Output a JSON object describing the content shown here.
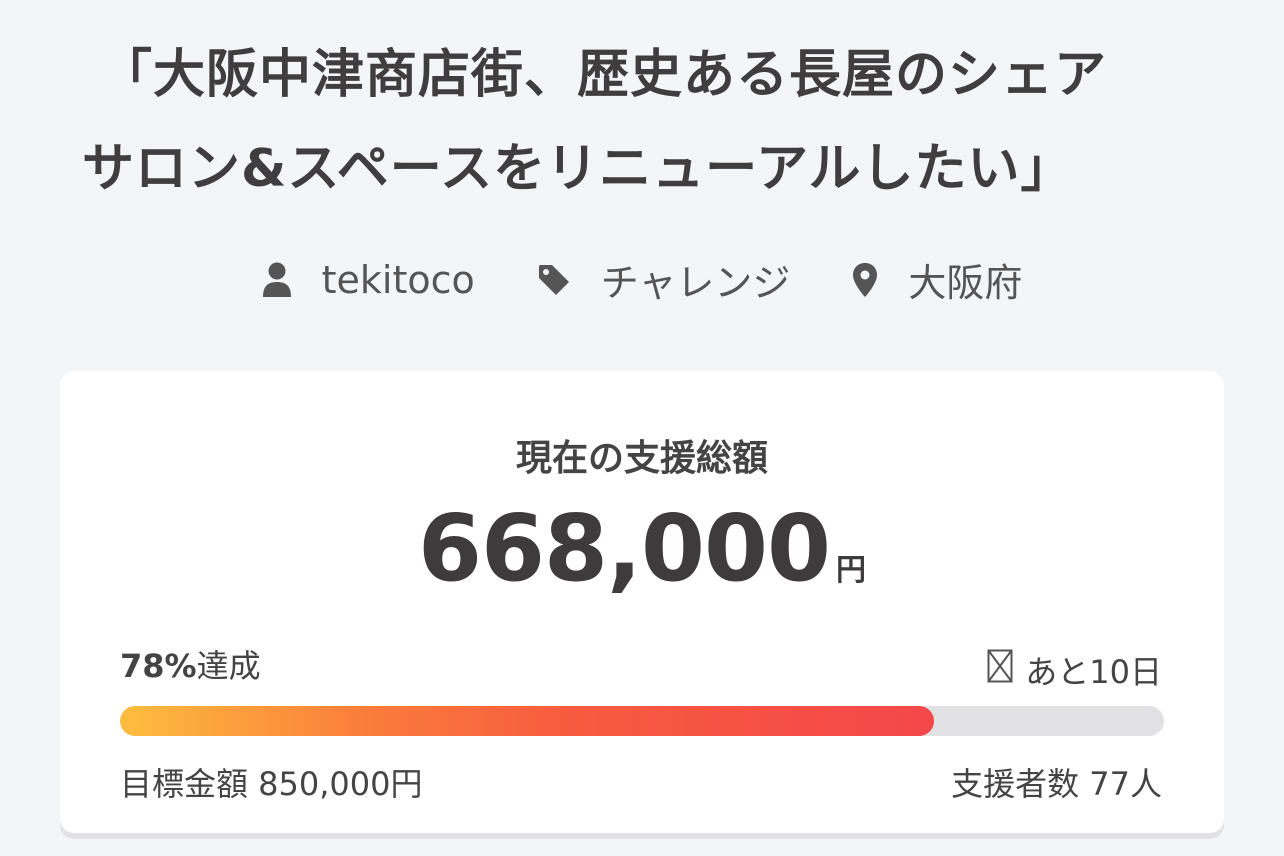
{
  "project": {
    "title_line1": "「大阪中津商店街、歴史ある長屋のシェア",
    "title_line2": "サロン&スペースをリニューアルしたい」"
  },
  "meta": {
    "author": "tekitoco",
    "author_icon": "person-icon",
    "category": "チャレンジ",
    "category_icon": "tag-icon",
    "location": "大阪府",
    "location_icon": "location-pin-icon"
  },
  "funding": {
    "label": "現在の支援総額",
    "amount": "668,000",
    "currency": "円",
    "achievement_percent": "78%",
    "achievement_suffix": "達成",
    "progress": 0.78,
    "remaining_icon": "hourglass-icon",
    "remaining_text": "あと10日",
    "goal_text": "目標金額 850,000円",
    "supporters_text": "支援者数 77人"
  },
  "colors": {
    "background": "#f4f5f7",
    "card": "#ffffff",
    "text": "#444444",
    "progress_start": "#fdbd3e",
    "progress_end": "#f4474a",
    "progress_track": "#e1e1e3"
  }
}
